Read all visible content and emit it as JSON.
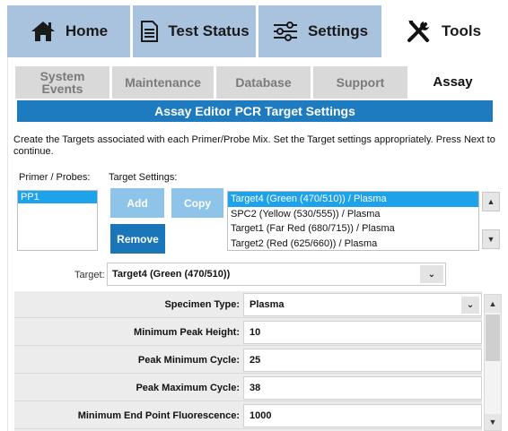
{
  "nav": {
    "home": "Home",
    "test_status": "Test Status",
    "settings": "Settings",
    "tools": "Tools"
  },
  "subtabs": {
    "system_events": "System\nEvents",
    "maintenance": "Maintenance",
    "database": "Database",
    "support": "Support",
    "assay": "Assay"
  },
  "editor": {
    "title": "Assay Editor PCR Target Settings",
    "instructions": "Create the Targets associated with each Primer/Probe Mix. Set the Target settings appropriately. Press Next to continue.",
    "primer_probes_label": "Primer / Probes:",
    "target_settings_label": "Target Settings:",
    "primer_probes": [
      "PP1"
    ],
    "add_label": "Add",
    "copy_label": "Copy",
    "remove_label": "Remove",
    "targets": [
      "Target4 (Green (470/510)) / Plasma",
      "SPC2 (Yellow (530/555)) / Plasma",
      "Target1 (Far Red (680/715)) / Plasma",
      "Target2 (Red (625/660)) / Plasma"
    ],
    "target_label": "Target:",
    "target_value": "Target4 (Green (470/510))"
  },
  "settings": {
    "specimen_type_label": "Specimen Type:",
    "specimen_type_value": "Plasma",
    "min_peak_height_label": "Minimum Peak Height:",
    "min_peak_height_value": "10",
    "peak_min_cycle_label": "Peak Minimum Cycle:",
    "peak_min_cycle_value": "25",
    "peak_max_cycle_label": "Peak Maximum Cycle:",
    "peak_max_cycle_value": "38",
    "min_end_point_label": "Minimum End Point Fluorescence:",
    "min_end_point_value": "1000"
  },
  "icons": {
    "home": "home-icon",
    "test_status": "document-icon",
    "settings": "sliders-icon",
    "tools": "tools-icon"
  },
  "colors": {
    "nav_bg": "#a9c3df",
    "title_bar": "#1f7bbf",
    "selection": "#1ea2ea",
    "button_light": "#8ec3ea",
    "button_dark": "#1a76b8"
  }
}
